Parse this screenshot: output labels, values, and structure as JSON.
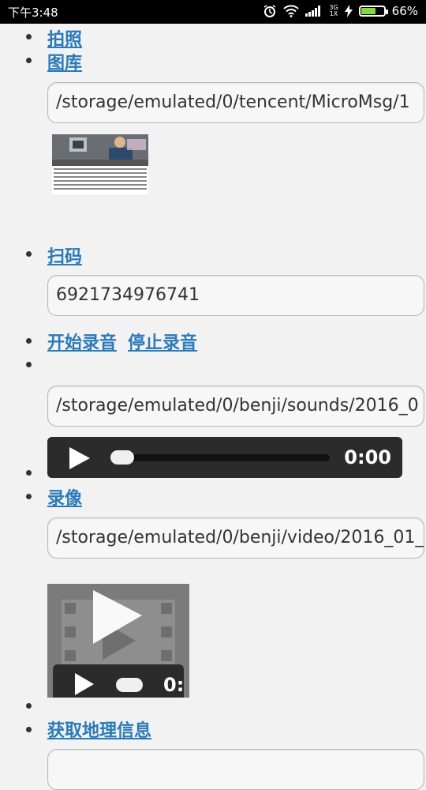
{
  "status_bar": {
    "time": "下午3:48",
    "network_top": "3G",
    "network_bottom": "1X",
    "battery_percent": "66%",
    "battery_level": 0.66,
    "icons": [
      "alarm-icon",
      "wifi-icon",
      "signal-icon",
      "bolt-icon",
      "battery-icon"
    ]
  },
  "items": {
    "take_photo": "拍照",
    "gallery": "图库",
    "gallery_path": "/storage/emulated/0/tencent/MicroMsg/1",
    "scan": "扫码",
    "scan_result": "6921734976741",
    "start_recording": "开始录音",
    "stop_recording": "停止录音",
    "sound_path": "/storage/emulated/0/benji/sounds/2016_0",
    "audio_time": "0:00",
    "video": "录像",
    "video_path": "/storage/emulated/0/benji/video/2016_01_",
    "video_time": "0:",
    "geo_info": "获取地理信息"
  },
  "colors": {
    "link": "#2a7ab8",
    "background": "#f2f2f2",
    "player": "#2b2b2b",
    "battery": "#7ddc3a"
  }
}
